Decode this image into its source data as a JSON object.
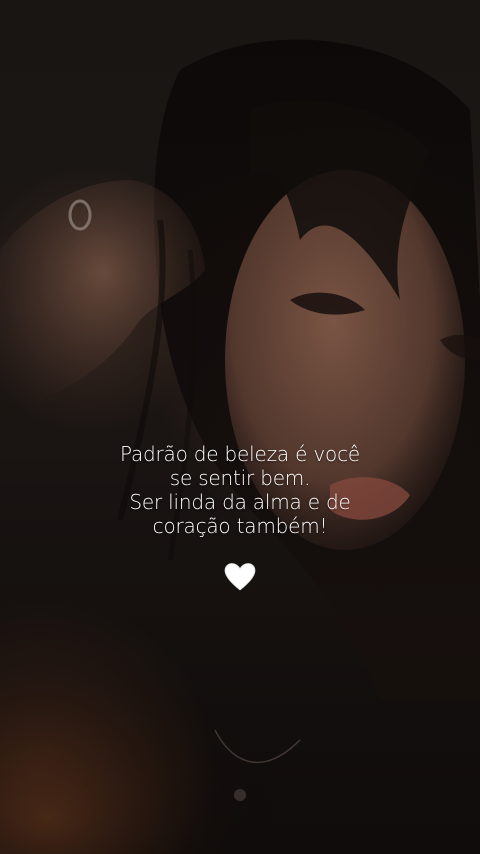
{
  "quote": {
    "lines": [
      "Padrão de beleza é você",
      "se sentir bem.",
      "Ser linda da alma e de",
      "coração também!"
    ]
  },
  "emoji": {
    "icon": "white-heart-icon",
    "color": "#ffffff"
  },
  "palette": {
    "background": "#1a1412",
    "skin_tone": "#8c6350",
    "hair": "#120d0b"
  }
}
